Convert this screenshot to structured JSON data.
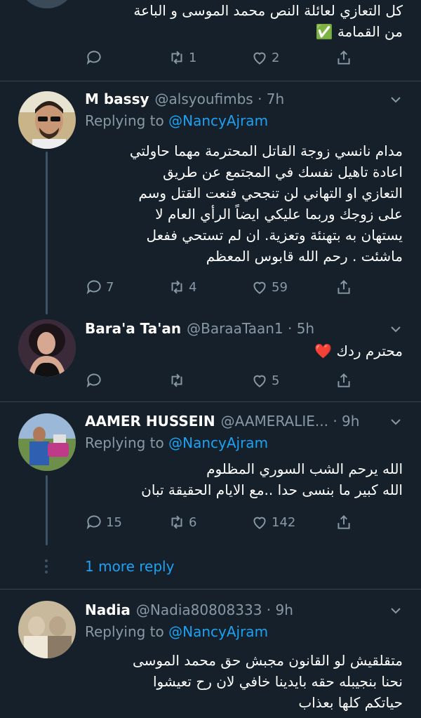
{
  "tweets": [
    {
      "name": "",
      "handle": "",
      "time": "",
      "body": [
        "كل التعازي لعائلة النص محمد الموسى و الباعة",
        "من القمامة ✅"
      ],
      "stats": {
        "reply": "",
        "retweet": "1",
        "like": "2"
      }
    },
    {
      "name": "M bassy",
      "handle": "@alsyoufimbs · 7h",
      "replying_label": "Replying to",
      "replying_to": "@NancyAjram",
      "body": [
        "مدام نانسي زوجة القاتل المحترمة مهما حاولتي",
        "اعادة تاهيل نفسك في المجتمع عن طريق",
        "التعازي او التهاني لن تنجحي فنعت القتل وسم",
        "على زوجك وربما عليكي ايضاً الرأي العام لا",
        "يستهان به بتهنئة وتعزية. ان لم تستحي ففعل",
        "ماشئت . رحم الله قابوس المعظم"
      ],
      "stats": {
        "reply": "7",
        "retweet": "4",
        "like": "59"
      }
    },
    {
      "name": "Bara'a Ta'an",
      "handle": "@BaraaTaan1 · 5h",
      "body": [
        "محترم ردك ❤️"
      ],
      "stats": {
        "reply": "",
        "retweet": "",
        "like": "5"
      }
    },
    {
      "name": "AAMER HUSSEIN",
      "handle": "@AAMERALIE... · 9h",
      "replying_label": "Replying to",
      "replying_to": "@NancyAjram",
      "body": [
        "الله يرحم الشب السوري المظلوم",
        "الله كبير ما بنسى حدا ..مع الايام الحقيقة تبان"
      ],
      "stats": {
        "reply": "15",
        "retweet": "6",
        "like": "142"
      }
    },
    {
      "name": "Nadia",
      "handle": "@Nadia80808333 · 9h",
      "replying_label": "Replying to",
      "replying_to": "@NancyAjram",
      "body": [
        "متقلقيش لو القانون مجبش حق محمد الموسى",
        "نحنا بنجيبله حقه بايدينا خافي لان رح تعيشوا",
        "حياتكم كلها بعذاب"
      ]
    }
  ],
  "more_replies": "1 more reply",
  "icons": [
    "reply-icon",
    "retweet-icon",
    "like-icon",
    "share-icon",
    "caret-down-icon"
  ],
  "colors": {
    "background": "#15202b",
    "muted": "#8899a6",
    "accent": "#1da1f2",
    "divider": "#38444d"
  }
}
